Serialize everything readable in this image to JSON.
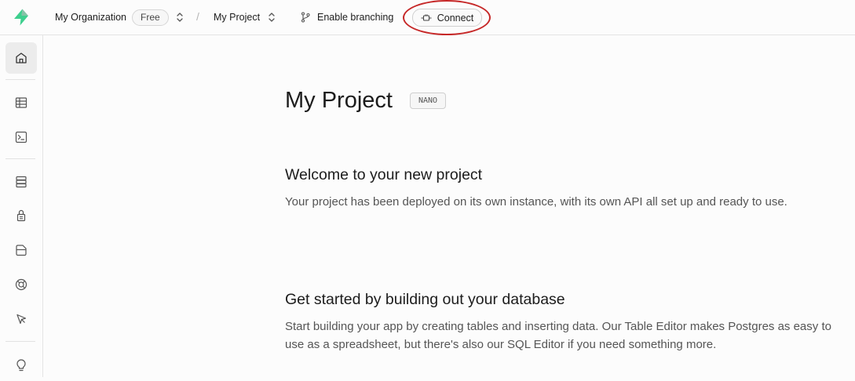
{
  "topbar": {
    "org_name": "My Organization",
    "plan": "Free",
    "separator": "/",
    "project_name": "My Project",
    "branch_label": "Enable branching",
    "connect_label": "Connect"
  },
  "sidebar": {
    "items": [
      {
        "icon": "home-icon",
        "active": true
      },
      {
        "icon": "table-editor-icon"
      },
      {
        "icon": "sql-editor-icon"
      },
      {
        "icon": "database-icon"
      },
      {
        "icon": "auth-icon"
      },
      {
        "icon": "storage-icon"
      },
      {
        "icon": "realtime-icon"
      },
      {
        "icon": "cursor-icon"
      },
      {
        "icon": "lightbulb-icon"
      }
    ]
  },
  "main": {
    "title": "My Project",
    "size_badge": "NANO",
    "welcome": {
      "title": "Welcome to your new project",
      "body": "Your project has been deployed on its own instance, with its own API all set up and ready to use."
    },
    "get_started": {
      "title": "Get started by building out your database",
      "body": "Start building your app by creating tables and inserting data. Our Table Editor makes Postgres as easy to use as a spreadsheet, but there's also our SQL Editor if you need something more."
    }
  },
  "colors": {
    "brand": "#3ecf8e",
    "annotation": "#c62828"
  }
}
